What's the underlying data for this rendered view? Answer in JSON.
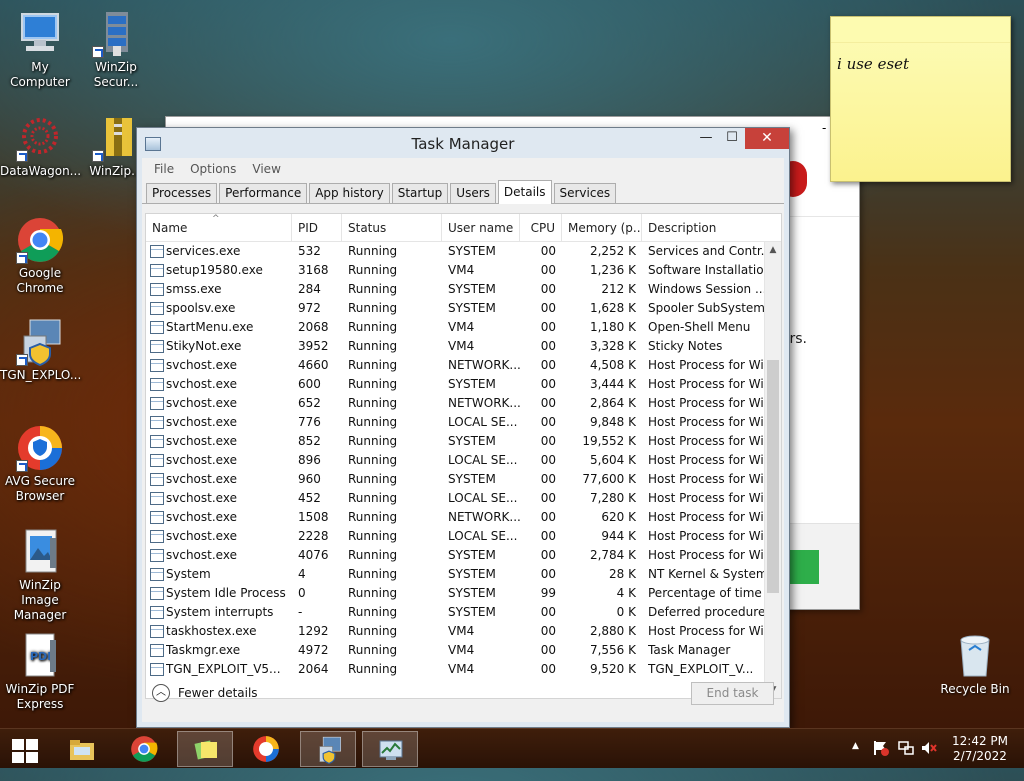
{
  "desktop": {
    "icons": [
      {
        "label": "My Computer",
        "icon": "computer-icon"
      },
      {
        "label": "WinZip Secur...",
        "icon": "winzip-secure-icon"
      },
      {
        "label": "DataWagon...",
        "icon": "datawagon-icon"
      },
      {
        "label": "WinZip...",
        "icon": "winzip-icon"
      },
      {
        "label": "Google Chrome",
        "icon": "chrome-icon"
      },
      {
        "label": "TGN_EXPLO...",
        "icon": "installer-icon"
      },
      {
        "label": "AVG Secure Browser",
        "icon": "avg-browser-icon"
      },
      {
        "label": "WinZip Image Manager",
        "icon": "winzip-image-icon"
      },
      {
        "label": "WinZip PDF Express",
        "icon": "pdf-icon"
      },
      {
        "label": "Recycle Bin",
        "icon": "recycle-bin-icon"
      }
    ]
  },
  "sticky_note": {
    "text": "i use eset"
  },
  "background_window": {
    "controls": {
      "minimize": "-",
      "close": "x"
    },
    "partial_text": "rs."
  },
  "task_manager": {
    "title": "Task Manager",
    "window_buttons": {
      "minimize": "—",
      "maximize": "☐",
      "close": "✕"
    },
    "menu": [
      "File",
      "Options",
      "View"
    ],
    "tabs": [
      "Processes",
      "Performance",
      "App history",
      "Startup",
      "Users",
      "Details",
      "Services"
    ],
    "active_tab": "Details",
    "columns": [
      "Name",
      "PID",
      "Status",
      "User name",
      "CPU",
      "Memory (p...",
      "Description"
    ],
    "rows": [
      [
        "services.exe",
        "532",
        "Running",
        "SYSTEM",
        "00",
        "2,252 K",
        "Services and Contr..."
      ],
      [
        "setup19580.exe",
        "3168",
        "Running",
        "VM4",
        "00",
        "1,236 K",
        "Software Installation"
      ],
      [
        "smss.exe",
        "284",
        "Running",
        "SYSTEM",
        "00",
        "212 K",
        "Windows Session ..."
      ],
      [
        "spoolsv.exe",
        "972",
        "Running",
        "SYSTEM",
        "00",
        "1,628 K",
        "Spooler SubSystem..."
      ],
      [
        "StartMenu.exe",
        "2068",
        "Running",
        "VM4",
        "00",
        "1,180 K",
        "Open-Shell Menu"
      ],
      [
        "StikyNot.exe",
        "3952",
        "Running",
        "VM4",
        "00",
        "3,328 K",
        "Sticky Notes"
      ],
      [
        "svchost.exe",
        "4660",
        "Running",
        "NETWORK...",
        "00",
        "4,508 K",
        "Host Process for Wi..."
      ],
      [
        "svchost.exe",
        "600",
        "Running",
        "SYSTEM",
        "00",
        "3,444 K",
        "Host Process for Wi..."
      ],
      [
        "svchost.exe",
        "652",
        "Running",
        "NETWORK...",
        "00",
        "2,864 K",
        "Host Process for Wi..."
      ],
      [
        "svchost.exe",
        "776",
        "Running",
        "LOCAL SE...",
        "00",
        "9,848 K",
        "Host Process for Wi..."
      ],
      [
        "svchost.exe",
        "852",
        "Running",
        "SYSTEM",
        "00",
        "19,552 K",
        "Host Process for Wi..."
      ],
      [
        "svchost.exe",
        "896",
        "Running",
        "LOCAL SE...",
        "00",
        "5,604 K",
        "Host Process for Wi..."
      ],
      [
        "svchost.exe",
        "960",
        "Running",
        "SYSTEM",
        "00",
        "77,600 K",
        "Host Process for Wi..."
      ],
      [
        "svchost.exe",
        "452",
        "Running",
        "LOCAL SE...",
        "00",
        "7,280 K",
        "Host Process for Wi..."
      ],
      [
        "svchost.exe",
        "1508",
        "Running",
        "NETWORK...",
        "00",
        "620 K",
        "Host Process for Wi..."
      ],
      [
        "svchost.exe",
        "2228",
        "Running",
        "LOCAL SE...",
        "00",
        "944 K",
        "Host Process for Wi..."
      ],
      [
        "svchost.exe",
        "4076",
        "Running",
        "SYSTEM",
        "00",
        "2,784 K",
        "Host Process for Wi..."
      ],
      [
        "System",
        "4",
        "Running",
        "SYSTEM",
        "00",
        "28 K",
        "NT Kernel & System"
      ],
      [
        "System Idle Process",
        "0",
        "Running",
        "SYSTEM",
        "99",
        "4 K",
        "Percentage of time ..."
      ],
      [
        "System interrupts",
        "-",
        "Running",
        "SYSTEM",
        "00",
        "0 K",
        "Deferred procedure..."
      ],
      [
        "taskhostex.exe",
        "1292",
        "Running",
        "VM4",
        "00",
        "2,880 K",
        "Host Process for Wi..."
      ],
      [
        "Taskmgr.exe",
        "4972",
        "Running",
        "VM4",
        "00",
        "7,556 K",
        "Task Manager"
      ],
      [
        "TGN_EXPLOIT_V5...",
        "2064",
        "Running",
        "VM4",
        "00",
        "9,520 K",
        "TGN_EXPLOIT_V..."
      ]
    ],
    "fewer_details": "Fewer details",
    "end_task": "End task"
  },
  "taskbar": {
    "pinned": [
      "start-button",
      "file-explorer-icon",
      "chrome-icon",
      "sticky-notes-icon",
      "avg-browser-icon",
      "installer-icon",
      "task-manager-icon"
    ],
    "clock_time": "12:42 PM",
    "clock_date": "2/7/2022"
  },
  "colors": {
    "close_red": "#c7413a",
    "sticky_yellow": "#fbf28e",
    "taskbar": "#2a1206"
  }
}
